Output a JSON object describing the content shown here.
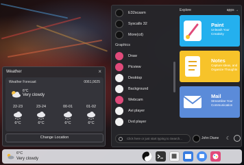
{
  "weather_window": {
    "title": "Weather",
    "card_title": "Weather Forecast",
    "time": "0061,0025",
    "current": {
      "temp": "6°C",
      "desc": "Very clowdy"
    },
    "forecast": [
      {
        "day": "22-23",
        "temp": "6°C",
        "icon": "cloud-snow-icon"
      },
      {
        "day": "23-24",
        "temp": "6°C",
        "icon": "cloud-snow-icon"
      },
      {
        "day": "00-01",
        "temp": "6°C",
        "icon": "cloud-snow-icon"
      },
      {
        "day": "01-02",
        "temp": "6°C",
        "icon": "cloud-snow-icon"
      }
    ],
    "button": "Change Location"
  },
  "start_menu": {
    "apps_top": [
      {
        "label": "E32scasm"
      },
      {
        "label": "Syscalls 32"
      },
      {
        "label": "More(cd)"
      }
    ],
    "section": "Graphics",
    "apps": [
      {
        "label": "Draw",
        "color": "#e04a7a"
      },
      {
        "label": "Picview",
        "color": "#e04a7a"
      },
      {
        "label": "Desktop",
        "color": "#f2f2f2"
      },
      {
        "label": "Background",
        "color": "#f2f2f2"
      },
      {
        "label": "Webcam",
        "color": "#e04a7a"
      },
      {
        "label": "Avi player",
        "color": "#f2f2f2"
      },
      {
        "label": "Dvd player",
        "color": "#f2f2f2"
      }
    ],
    "explore": "Explore",
    "apps_link": "apps →",
    "tiles": [
      {
        "name": "Paint",
        "desc": "Unleash Your Creativity",
        "bg": "#24b0ee",
        "fg": "#ffffff"
      },
      {
        "name": "Notes",
        "desc": "Capture Ideas, and Organize Thoughts",
        "bg": "#f7c32a",
        "fg": "#ffffff"
      },
      {
        "name": "Mail",
        "desc": "Streamline Your Communication",
        "bg": "#5b8bd9",
        "fg": "#ffffff"
      }
    ],
    "search_placeholder": "Click here or just start typing to Search...",
    "user": "John Diane"
  },
  "taskbar": {
    "temp": "6°C",
    "desc": "Very clowdy",
    "icons": [
      "yin-yang-icon",
      "terminal-icon",
      "chip-icon",
      "window-icon",
      "chat-icon",
      "files-icon",
      "paint-icon",
      "desktop-icon"
    ]
  }
}
